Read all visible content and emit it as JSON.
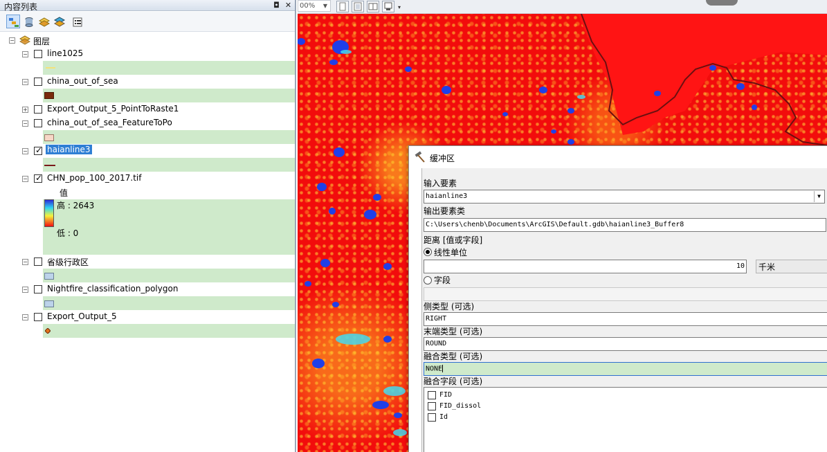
{
  "toc": {
    "title": "内容列表",
    "pin_glyph": "◘",
    "close_glyph": "✕",
    "root_label": "图层",
    "layers": [
      {
        "name": "line1025",
        "checked": false,
        "expanded": true
      },
      {
        "name": "china_out_of_sea",
        "checked": false,
        "expanded": true
      },
      {
        "name": "Export_Output_5_PointToRaste1",
        "checked": false,
        "expanded": false
      },
      {
        "name": "china_out_of_sea_FeatureToPo",
        "checked": false,
        "expanded": true
      },
      {
        "name": "haianline3",
        "checked": true,
        "expanded": true,
        "selected": true
      },
      {
        "name": "CHN_pop_100_2017.tif",
        "checked": true,
        "expanded": true
      },
      {
        "name": "省级行政区",
        "checked": false,
        "expanded": true
      },
      {
        "name": "Nightfire_classification_polygon",
        "checked": false,
        "expanded": true
      },
      {
        "name": "Export_Output_5",
        "checked": false,
        "expanded": true
      }
    ],
    "raster_legend": {
      "field": "值",
      "high": "高 : 2643",
      "low": "低 : 0"
    }
  },
  "map_toolbar": {
    "zoom_value": "00%"
  },
  "dialog": {
    "title": "缓冲区",
    "input_label": "输入要素",
    "input_value": "haianline3",
    "output_label": "输出要素类",
    "output_value": "C:\\Users\\chenb\\Documents\\ArcGIS\\Default.gdb\\haianline3_Buffer8",
    "distance_label": "距离 [值或字段]",
    "linear_unit_label": "线性单位",
    "distance_value": "10",
    "unit_value": "千米",
    "field_label": "字段",
    "side_type_label": "侧类型 (可选)",
    "side_type_value": "RIGHT",
    "end_type_label": "末端类型 (可选)",
    "end_type_value": "ROUND",
    "dissolve_type_label": "融合类型 (可选)",
    "dissolve_type_value": "NONE",
    "dissolve_field_label": "融合字段 (可选)",
    "dissolve_fields": [
      "FID",
      "FID_dissol",
      "Id"
    ]
  },
  "colors": {
    "map_red": "#f20c0c",
    "legend_green": "#cfeacb",
    "selection_blue": "#2f7fd4"
  }
}
